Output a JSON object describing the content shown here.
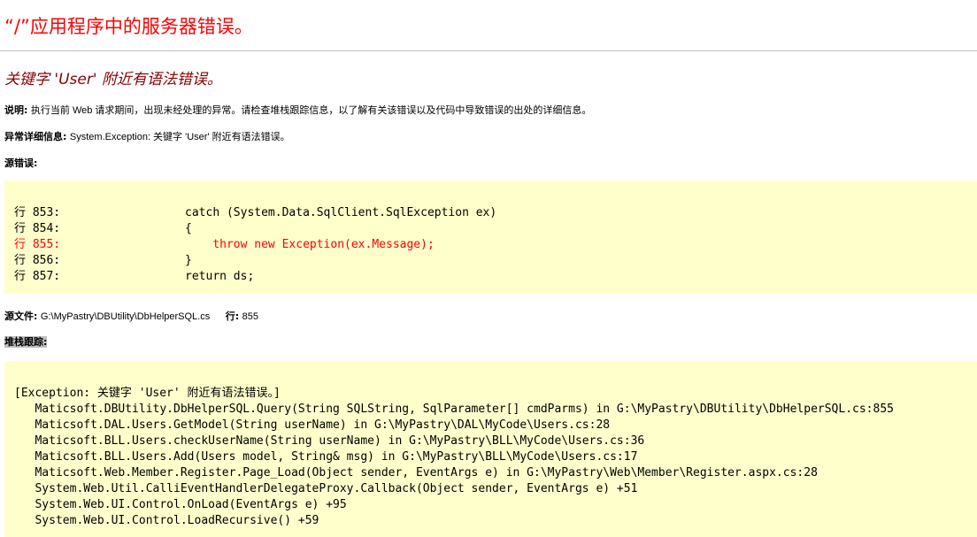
{
  "page_title": "“/”应用程序中的服务器错误。",
  "error_title": "关键字 'User' 附近有语法错误。",
  "description": {
    "label": "说明:",
    "text": "执行当前 Web 请求期间，出现未经处理的异常。请检查堆栈跟踪信息，以了解有关该错误以及代码中导致错误的出处的详细信息。"
  },
  "exception_details": {
    "label": "异常详细信息:",
    "text": "System.Exception: 关键字 'User' 附近有语法错误。"
  },
  "source_error": {
    "label": "源错误:",
    "lines": [
      {
        "text": "行 853:                  catch (System.Data.SqlClient.SqlException ex)",
        "highlight": false
      },
      {
        "text": "行 854:                  {",
        "highlight": false
      },
      {
        "text": "行 855:                      throw new Exception(ex.Message);",
        "highlight": true
      },
      {
        "text": "行 856:                  }",
        "highlight": false
      },
      {
        "text": "行 857:                  return ds;",
        "highlight": false
      }
    ]
  },
  "source_file": {
    "label": "源文件:",
    "path": "G:\\MyPastry\\DBUtility\\DbHelperSQL.cs",
    "line_label": "行:",
    "line_number": "855"
  },
  "stack_trace": {
    "label": "堆栈跟踪:",
    "lines": [
      "[Exception: 关键字 'User' 附近有语法错误。]",
      "   Maticsoft.DBUtility.DbHelperSQL.Query(String SQLString, SqlParameter[] cmdParms) in G:\\MyPastry\\DBUtility\\DbHelperSQL.cs:855",
      "   Maticsoft.DAL.Users.GetModel(String userName) in G:\\MyPastry\\DAL\\MyCode\\Users.cs:28",
      "   Maticsoft.BLL.Users.checkUserName(String userName) in G:\\MyPastry\\BLL\\MyCode\\Users.cs:36",
      "   Maticsoft.BLL.Users.Add(Users model, String& msg) in G:\\MyPastry\\BLL\\MyCode\\Users.cs:17",
      "   Maticsoft.Web.Member.Register.Page_Load(Object sender, EventArgs e) in G:\\MyPastry\\Web\\Member\\Register.aspx.cs:28",
      "   System.Web.Util.CalliEventHandlerDelegateProxy.Callback(Object sender, EventArgs e) +51",
      "   System.Web.UI.Control.OnLoad(EventArgs e) +95",
      "   System.Web.UI.Control.LoadRecursive() +59"
    ]
  },
  "colors": {
    "title": "#ff0000",
    "error_title": "#8b0000",
    "code_background": "#ffffcc",
    "highlight_line": "#ff0000"
  }
}
